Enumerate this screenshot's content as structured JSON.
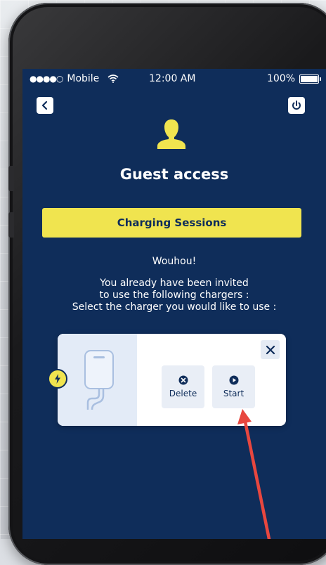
{
  "status_bar": {
    "signal": "●●●●○",
    "carrier": "Mobile",
    "time": "12:00 AM",
    "battery": "100%"
  },
  "header": {
    "title": "Guest access",
    "back_icon": "chevron-left-icon",
    "power_icon": "power-icon",
    "avatar_icon": "user-icon"
  },
  "sessions_button": {
    "label": "Charging Sessions"
  },
  "message": {
    "exclamation": "Wouhou!",
    "line1": "You already have been invited",
    "line2": "to use the following chargers :",
    "line3": "Select the charger you would like to use :"
  },
  "charger_card": {
    "delete_label": "Delete",
    "start_label": "Start",
    "delete_icon": "x-circle-icon",
    "start_icon": "play-circle-icon",
    "close_icon": "close-icon"
  },
  "colors": {
    "screen_bg": "#0f2d5a",
    "accent": "#f0e44f",
    "card_bg": "#ffffff",
    "annotation": "#e8473f"
  }
}
